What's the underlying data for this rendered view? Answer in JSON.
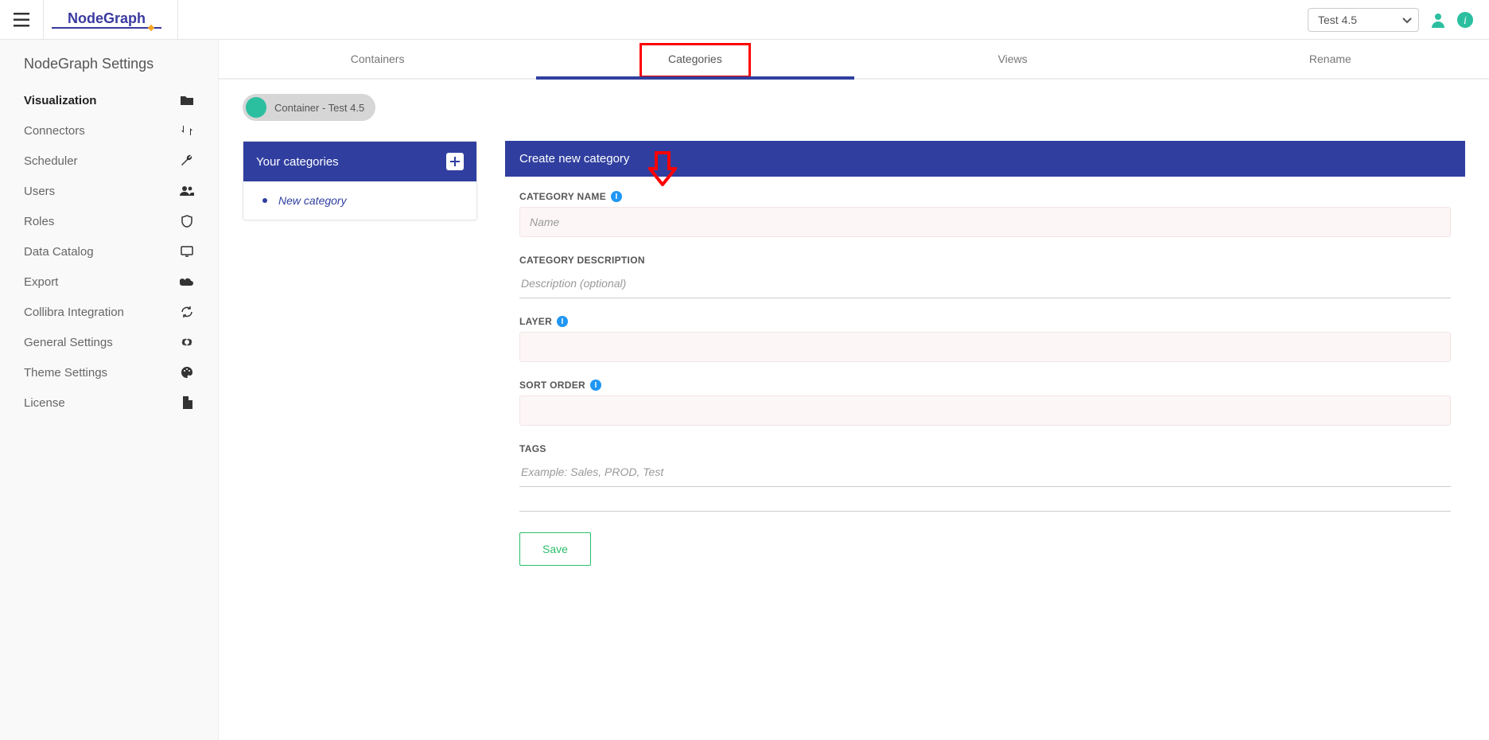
{
  "header": {
    "brand_prefix": "Node",
    "brand_suffix": "Graph",
    "env_selected": "Test 4.5"
  },
  "sidebar": {
    "title": "NodeGraph Settings",
    "items": [
      {
        "label": "Visualization",
        "icon": "folder-icon",
        "active": true
      },
      {
        "label": "Connectors",
        "icon": "swap-icon"
      },
      {
        "label": "Scheduler",
        "icon": "wrench-icon"
      },
      {
        "label": "Users",
        "icon": "users-icon"
      },
      {
        "label": "Roles",
        "icon": "shield-icon"
      },
      {
        "label": "Data Catalog",
        "icon": "monitor-icon"
      },
      {
        "label": "Export",
        "icon": "cloud-icon"
      },
      {
        "label": "Collibra Integration",
        "icon": "sync-icon"
      },
      {
        "label": "General Settings",
        "icon": "gear-icon"
      },
      {
        "label": "Theme Settings",
        "icon": "palette-icon"
      },
      {
        "label": "License",
        "icon": "file-icon"
      }
    ]
  },
  "tabs": [
    "Containers",
    "Categories",
    "Views",
    "Rename"
  ],
  "active_tab": 1,
  "chip": {
    "label": "Container - Test 4.5"
  },
  "left_panel": {
    "title": "Your categories",
    "items": [
      "New category"
    ]
  },
  "form": {
    "title": "Create new category",
    "fields": {
      "name": {
        "label": "Category Name",
        "placeholder": "Name",
        "hasInfo": true,
        "type": "box"
      },
      "description": {
        "label": "Category Description",
        "placeholder": "Description (optional)",
        "type": "underline"
      },
      "layer": {
        "label": "Layer",
        "placeholder": "",
        "hasInfo": true,
        "type": "box"
      },
      "sort": {
        "label": "Sort Order",
        "placeholder": "",
        "hasInfo": true,
        "type": "box"
      },
      "tags": {
        "label": "Tags",
        "placeholder": "Example: Sales, PROD, Test",
        "type": "underline"
      }
    },
    "save_label": "Save"
  }
}
